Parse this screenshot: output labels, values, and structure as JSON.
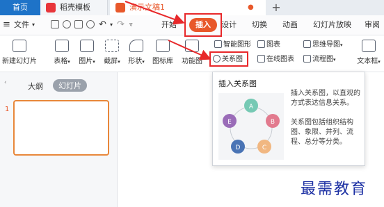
{
  "tabs": {
    "home": "首页",
    "template": "稻壳模板",
    "doc": "演示文稿1",
    "new_tab": "+"
  },
  "menubar": {
    "file": "文件",
    "start": "开始",
    "insert": "插入",
    "design": "设计",
    "switch": "切换",
    "animation": "动画",
    "slideshow": "幻灯片放映",
    "review": "审阅"
  },
  "ribbon": {
    "new_slide": "新建幻灯片",
    "table": "表格",
    "picture": "图片",
    "screenshot": "截屏",
    "shape": "形状",
    "icon_lib": "图标库",
    "function": "功能图",
    "smart_art": "智能图形",
    "chart": "图表",
    "relation_chart": "关系图",
    "online_chart": "在线图表",
    "mind_map": "思维导图",
    "flowchart": "流程图",
    "textbox": "文本框"
  },
  "left_panel": {
    "outline_tab": "大纲",
    "slides_tab": "幻灯片",
    "slide_number": "1"
  },
  "tooltip": {
    "title": "插入关系图",
    "desc1": "插入关系图，以直观的方式表达信息关系。",
    "desc2": "关系图包括组织结构图、象限、并列、流程、总分等分类。",
    "nodes": [
      "A",
      "B",
      "C",
      "D",
      "E"
    ]
  },
  "watermark": "最需教育",
  "colors": {
    "accent_orange": "#e8582a",
    "highlight_red": "#e8282a",
    "home_blue": "#1e73c8"
  }
}
